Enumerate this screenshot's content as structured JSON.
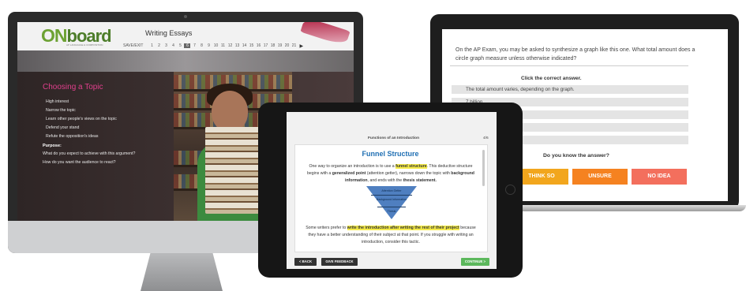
{
  "desktop": {
    "logo_on": "ON",
    "logo_board": "board",
    "logo_sub": "AP LANGUAGE & COMPOSITION",
    "title": "Writing Essays",
    "save_exit": "SAVE/EXIT",
    "pages": [
      "1",
      "2",
      "3",
      "4",
      "5",
      "6",
      "7",
      "8",
      "9",
      "10",
      "11",
      "12",
      "13",
      "14",
      "15",
      "16",
      "17",
      "18",
      "19",
      "20",
      "21"
    ],
    "active_page": "6",
    "next_icon": "triangle-right-icon",
    "heading": "Choosing a Topic",
    "bullets": [
      "High interest",
      "Narrow the topic",
      "Learn other people's views on the topic",
      "Defend your stand",
      "Refute the opposition's ideas"
    ],
    "purpose_label": "Purpose:",
    "purpose_questions": [
      "What do you expect to achieve with this argument?",
      "How do you want the audience to react?"
    ]
  },
  "laptop": {
    "question": "On the AP Exam, you may be asked to synthesize a graph like this one. What total amount does a circle graph measure unless otherwise indicated?",
    "instruction": "Click the correct answer.",
    "options": [
      "The total amount varies, depending on the graph.",
      "7 billion",
      "",
      "",
      ""
    ],
    "know_prompt": "Do you know the answer?",
    "buttons": [
      "THINK SO",
      "UNSURE",
      "NO IDEA"
    ],
    "button_colors": [
      "#f2a61d",
      "#f58220",
      "#f36f5d"
    ]
  },
  "tablet": {
    "section_title": "Functions of an Introduction",
    "page_indicator": "4/6",
    "card_heading": "Funnel Structure",
    "p1_a": "One way to organize an introduction is to use a ",
    "p1_hl": "funnel structure",
    "p1_b": ". This deductive structure begins with a ",
    "p1_c": "generalized point",
    "p1_d": " (attention getter), narrows down the topic with ",
    "p1_e": "background information",
    "p1_f": ", and ends with the ",
    "p1_g": "thesis statement.",
    "funnel_labels": [
      "Attention Getter",
      "Background Information",
      "Thesis"
    ],
    "p2_a": "Some writers prefer to ",
    "p2_hl": "write the introduction after writing the rest of their project",
    "p2_b": " because they have a better understanding of their subject at that point. If you struggle with writing an introduction, consider this tactic.",
    "back_button": "< BACK",
    "feedback_button": "GIVE FEEDBACK",
    "continue_button": "CONTINUE >",
    "accent_color": "#1f6fb3",
    "continue_color": "#5cb85c"
  }
}
